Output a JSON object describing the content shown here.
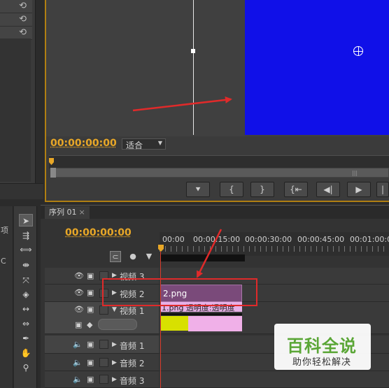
{
  "program_monitor": {
    "timecode": "00:00:00:00",
    "fit_label": "适合",
    "transport_buttons": [
      "⯆",
      "{",
      "}",
      "{⇤",
      "◀|",
      "▶",
      "|"
    ]
  },
  "sequence": {
    "tab_label": "序列 01",
    "tab_close": "×",
    "timecode": "00:00:00:00",
    "ruler_labels": [
      "00:00",
      "00:00:15:00",
      "00:00:30:00",
      "00:00:45:00",
      "00:01:00:00"
    ],
    "tracks": {
      "video3": "视频 3",
      "video2": "视频 2",
      "video1": "视频 1",
      "audio1": "音频 1",
      "audio2": "音频 2",
      "audio3": "音频 3"
    },
    "clips": {
      "clip2": "2.png",
      "clip1": "1.png  透明度:透明度"
    }
  },
  "left_edge_labels": [
    "项",
    "C"
  ],
  "watermark": {
    "title": "百科全说",
    "subtitle": "助你轻松解决"
  },
  "colors": {
    "accent": "#e8a727",
    "program_frame": "#1010e8",
    "annotation": "#e02a2a"
  }
}
